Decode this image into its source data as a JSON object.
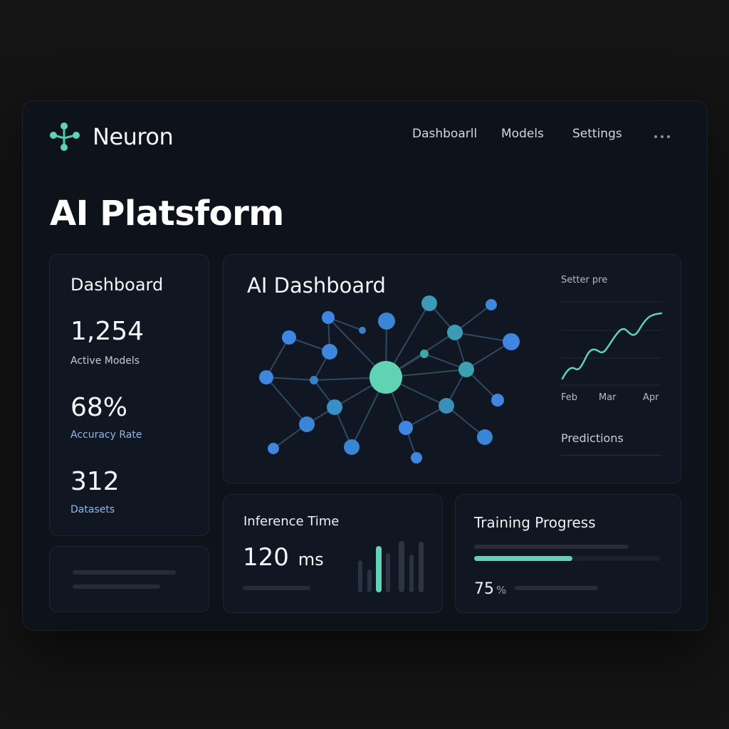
{
  "app": {
    "name": "Neuron",
    "page_title": "AI Platsform"
  },
  "nav": {
    "items": [
      "Dashboarll",
      "Models",
      "Settings"
    ]
  },
  "stats_card": {
    "title": "Dashboard",
    "stats": [
      {
        "value": "1,254",
        "label": "Active Models"
      },
      {
        "value": "68%",
        "label": "Accuracy Rate"
      },
      {
        "value": "312",
        "label": "Datasets"
      }
    ]
  },
  "main_card": {
    "title": "AI Dashboard",
    "side_chart": {
      "label": "Setter pre",
      "months": [
        "Feb",
        "Mar",
        "Apr"
      ],
      "footer": "Predictions"
    }
  },
  "inference": {
    "title": "Inference Time",
    "value": "120",
    "unit": "ms"
  },
  "training": {
    "title": "Training Progress",
    "value": "75",
    "unit": "%",
    "progress": 0.53
  },
  "colors": {
    "accent": "#5fd3b4",
    "node_blue": "#3f86e0",
    "background": "#0e121a"
  },
  "icons": {
    "logo": "neuron-logo-icon",
    "more": "more-horizontal-icon"
  }
}
